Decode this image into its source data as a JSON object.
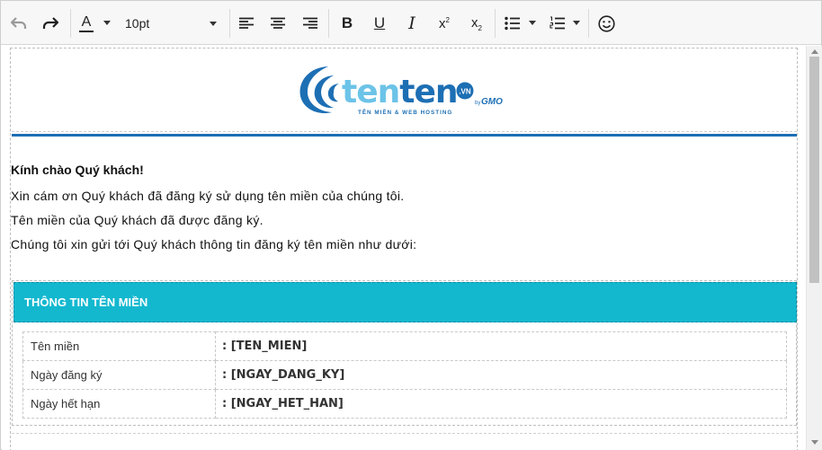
{
  "toolbar": {
    "undo_icon": "undo-icon",
    "redo_icon": "redo-icon",
    "font_color_icon": "font-color-icon",
    "font_color_glyph": "A",
    "font_size": "10pt",
    "align_icons": [
      "align-left-icon",
      "align-center-icon",
      "align-right-icon"
    ],
    "bold_glyph": "B",
    "underline_glyph": "U",
    "italic_glyph": "I",
    "superscript_glyph": "x",
    "subscript_glyph": "x",
    "superscript_mark": "2",
    "subscript_mark": "2",
    "emoji_icon": "smiley-icon",
    "colors": {
      "accent": "#13b8cf",
      "rule": "#1d6fb4"
    }
  },
  "email": {
    "logo": {
      "word1": "ten",
      "word2": "ten",
      "domain": ".VN",
      "by": "by",
      "gmo": "GMO",
      "tagline": "TÊN MIỀN & WEB HOSTING"
    },
    "greeting": "Kính chào Quý khách!",
    "lines": [
      "Xin cám ơn Quý khách đã đăng ký sử dụng tên miền của chúng tôi.",
      "Tên miền của Quý khách đã được đăng ký.",
      "Chúng tôi xin gửi tới Quý khách thông tin đăng ký tên miền như dưới:"
    ],
    "info_title": "THÔNG TIN TÊN MIỀN",
    "rows": [
      {
        "label": "Tên miền",
        "value": ": [TEN_MIEN]"
      },
      {
        "label": "Ngày đăng ký",
        "value": ": [NGAY_DANG_KY]"
      },
      {
        "label": "Ngày hết hạn",
        "value": ": [NGAY_HET_HAN]"
      }
    ]
  }
}
